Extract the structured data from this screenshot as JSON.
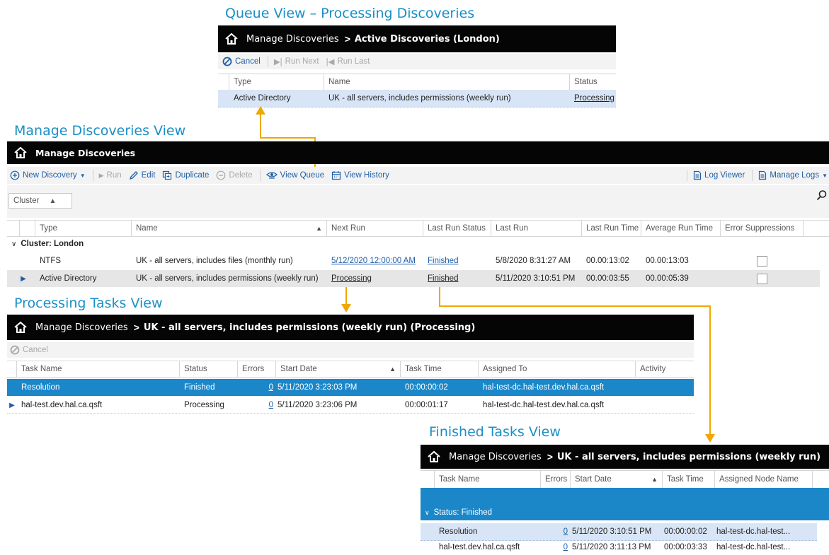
{
  "colors": {
    "accent": "#1a8fc6",
    "connector": "#f0a800",
    "selected": "#1b87c9",
    "highlight": "#d8e5f7"
  },
  "queue_view": {
    "title": "Queue View – Processing Discoveries",
    "crumb": "Manage Discoveries",
    "current": "Active Discoveries (London)",
    "toolbar": {
      "cancel": "Cancel",
      "run_next": "Run Next",
      "run_last": "Run Last"
    },
    "columns": [
      "Type",
      "Name",
      "Status"
    ],
    "rows": [
      {
        "type": "Active Directory",
        "name": "UK - all servers, includes permissions (weekly run)",
        "status": "Processing"
      }
    ]
  },
  "manage_view": {
    "title": "Manage Discoveries View",
    "header": "Manage Discoveries",
    "toolbar": {
      "new": "New Discovery",
      "run": "Run",
      "edit": "Edit",
      "duplicate": "Duplicate",
      "delete": "Delete",
      "view_queue": "View Queue",
      "view_history": "View History",
      "log_viewer": "Log Viewer",
      "manage_logs": "Manage Logs"
    },
    "group_chip": "Cluster",
    "columns": [
      "Type",
      "Name",
      "Next Run",
      "Last Run Status",
      "Last Run",
      "Last Run Time",
      "Average Run Time",
      "Error Suppressions"
    ],
    "group_label": "Cluster: London",
    "rows": [
      {
        "type": "NTFS",
        "name": "UK - all servers, includes files (monthly run)",
        "next_run": "5/12/2020 12:00:00 AM",
        "last_status": "Finished",
        "last_run": "5/8/2020 8:31:27 AM",
        "last_time": "00.00:13:02",
        "avg_time": "00.00:13:03"
      },
      {
        "type": "Active Directory",
        "name": "UK - all servers, includes permissions (weekly run)",
        "next_run": "Processing",
        "last_status": "Finished",
        "last_run": "5/11/2020 3:10:51 PM",
        "last_time": "00.00:03:55",
        "avg_time": "00.00:05:39"
      }
    ]
  },
  "processing_view": {
    "title": "Processing Tasks View",
    "crumb": "Manage Discoveries",
    "current": "UK - all servers, includes permissions (weekly run) (Processing)",
    "toolbar": {
      "cancel": "Cancel"
    },
    "columns": [
      "Task Name",
      "Status",
      "Errors",
      "Start Date",
      "Task Time",
      "Assigned To",
      "Activity"
    ],
    "rows": [
      {
        "task": "Resolution",
        "status": "Finished",
        "errors": "0",
        "start": "5/11/2020 3:23:03 PM",
        "time": "00:00:00:02",
        "assigned": "hal-test-dc.hal-test.dev.hal.ca.qsft"
      },
      {
        "task": "hal-test.dev.hal.ca.qsft",
        "status": "Processing",
        "errors": "0",
        "start": "5/11/2020 3:23:06 PM",
        "time": "00:00:01:17",
        "assigned": "hal-test-dc.hal-test.dev.hal.ca.qsft"
      }
    ]
  },
  "finished_view": {
    "title": "Finished Tasks View",
    "crumb": "Manage Discoveries",
    "current": "UK - all servers, includes permissions (weekly run)",
    "columns": [
      "Task Name",
      "Errors",
      "Start Date",
      "Task Time",
      "Assigned Node Name"
    ],
    "group_label": "Status: Finished",
    "rows": [
      {
        "task": "Resolution",
        "errors": "0",
        "start": "5/11/2020 3:10:51 PM",
        "time": "00:00:00:02",
        "assigned": "hal-test-dc.hal-test..."
      },
      {
        "task": "hal-test.dev.hal.ca.qsft",
        "errors": "0",
        "start": "5/11/2020 3:11:13 PM",
        "time": "00:00:03:33",
        "assigned": "hal-test-dc.hal-test..."
      }
    ]
  }
}
